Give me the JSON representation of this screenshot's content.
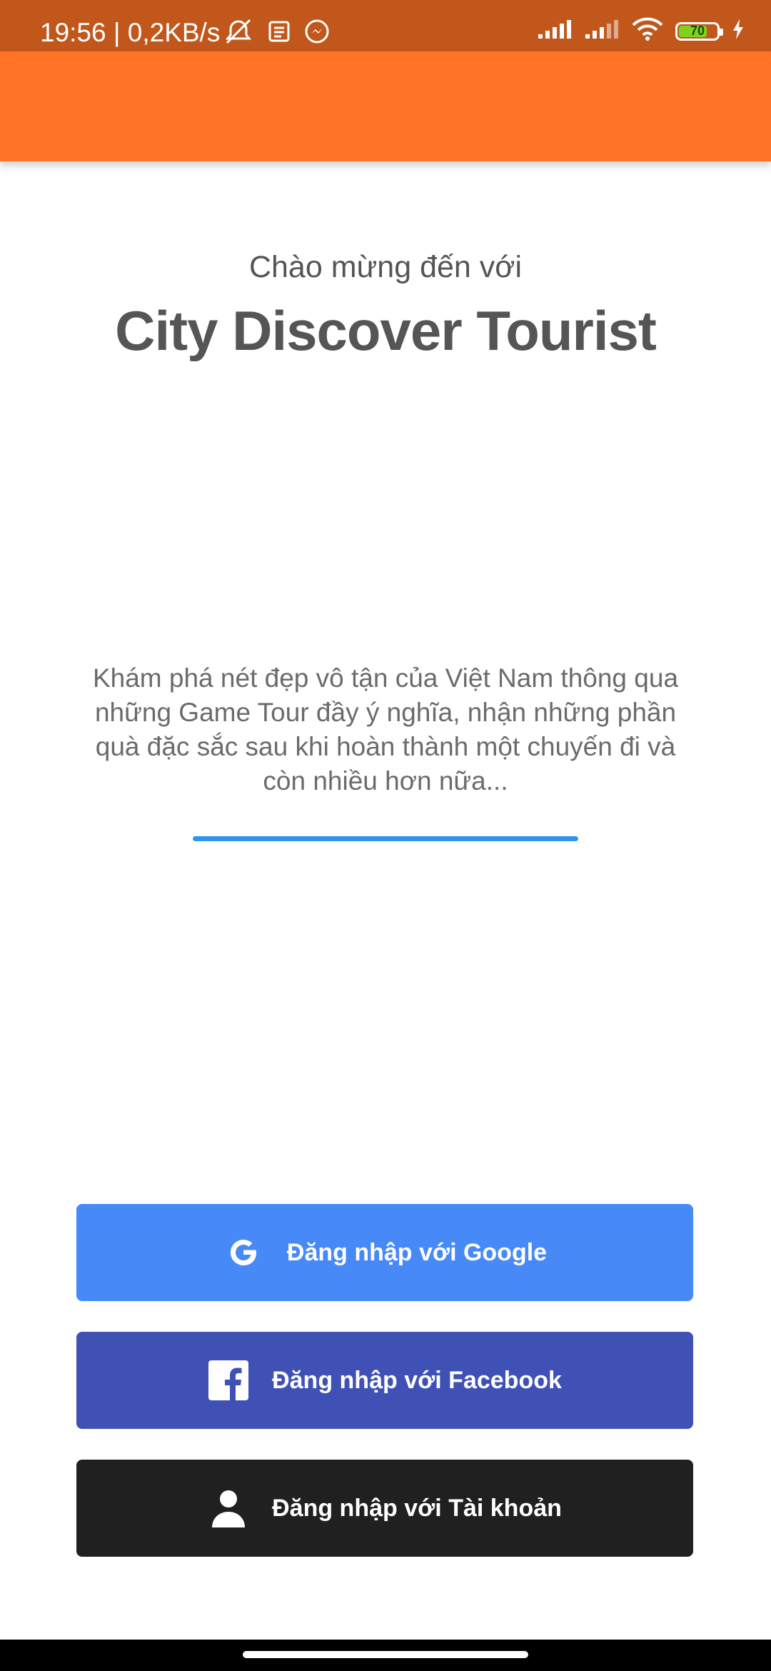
{
  "status_bar": {
    "time_net": "19:56 | 0,2KB/s",
    "battery_level": "70",
    "icons": [
      "mute-alarm-icon",
      "news-icon",
      "messenger-icon",
      "signal-icon",
      "signal-icon",
      "wifi-icon",
      "battery-icon",
      "charging-icon"
    ]
  },
  "welcome": {
    "greeting": "Chào mừng đến với",
    "app_name": "City Discover Tourist",
    "description": "Khám phá nét đẹp vô tận của Việt Nam thông qua những Game Tour đầy ý nghĩa, nhận những phần quà đặc sắc sau khi hoàn thành một chuyến đi và còn nhiều hơn nữa..."
  },
  "buttons": {
    "google_label": "Đăng nhập với Google",
    "facebook_label": "Đăng nhập với Facebook",
    "account_label": "Đăng nhập với Tài khoản"
  },
  "colors": {
    "status_bar": "#c1571b",
    "app_bar": "#ff7326",
    "google": "#4689f7",
    "facebook": "#3f51b5",
    "account": "#202020",
    "progress": "#2f95ec"
  }
}
